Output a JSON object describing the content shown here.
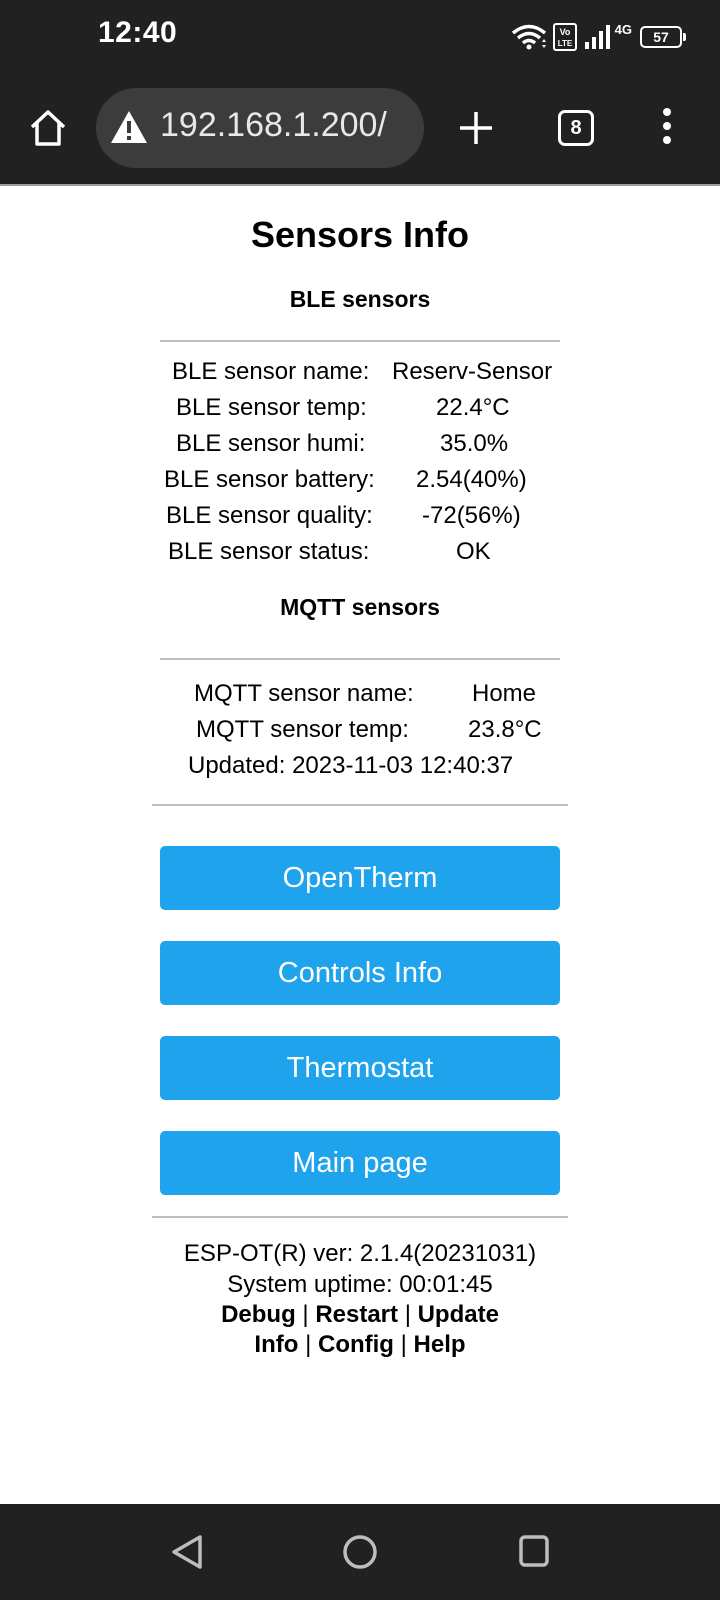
{
  "status_bar": {
    "time": "12:40",
    "network": "4G",
    "battery": "57",
    "icons": [
      "wifi-icon",
      "volte-icon",
      "signal-icon",
      "battery-icon"
    ]
  },
  "browser": {
    "url": "192.168.1.200/",
    "tab_count": "8",
    "icons": [
      "home-icon",
      "not-secure-warning-icon",
      "new-tab-icon",
      "overflow-menu-icon"
    ]
  },
  "page": {
    "title": "Sensors Info",
    "ble": {
      "heading": "BLE sensors",
      "rows": [
        {
          "label": "BLE sensor name:",
          "value": "Reserv-Sensor"
        },
        {
          "label": "BLE sensor temp:",
          "value": "22.4°C"
        },
        {
          "label": "BLE sensor humi:",
          "value": "35.0%"
        },
        {
          "label": "BLE sensor battery:",
          "value": "2.54(40%)"
        },
        {
          "label": "BLE sensor quality:",
          "value": "-72(56%)"
        },
        {
          "label": "BLE sensor status:",
          "value": "OK"
        }
      ]
    },
    "mqtt": {
      "heading": "MQTT sensors",
      "rows": [
        {
          "label": "MQTT sensor name:",
          "value": "Home"
        },
        {
          "label": "MQTT sensor temp:",
          "value": "23.8°C"
        }
      ],
      "updated": "Updated: 2023-11-03 12:40:37"
    },
    "buttons": [
      "OpenTherm",
      "Controls Info",
      "Thermostat",
      "Main page"
    ],
    "footer": {
      "version": "ESP-OT(R) ver: 2.1.4(20231031)",
      "uptime": "System uptime: 00:01:45",
      "links_row1": [
        "Debug",
        "Restart",
        "Update"
      ],
      "links_row2": [
        "Info",
        "Config",
        "Help"
      ],
      "separator": "|"
    },
    "button_color": "#1fa3ec"
  },
  "nav_bar": {
    "icons": [
      "back-icon",
      "home-circle-icon",
      "recents-icon"
    ]
  }
}
